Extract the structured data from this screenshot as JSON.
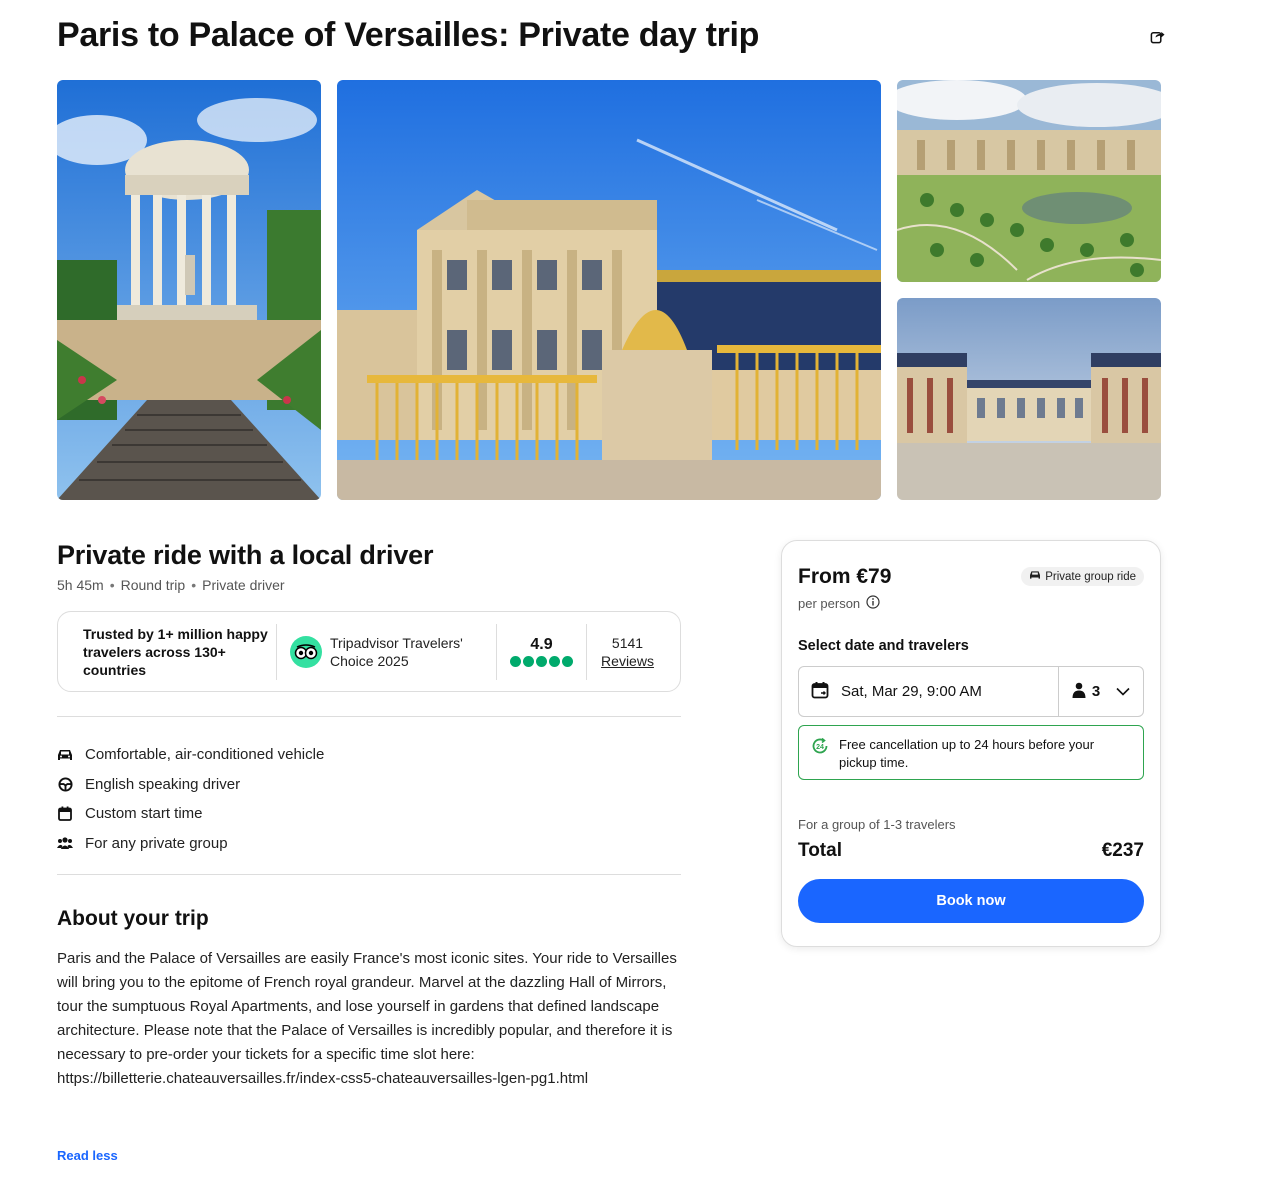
{
  "title": "Paris to Palace of Versailles: Private day trip",
  "gallery": {
    "photos": [
      "temple-of-love-photo",
      "palace-golden-gate-photo",
      "orangerie-gardens-photo",
      "marble-courtyard-photo"
    ]
  },
  "trip": {
    "heading": "Private ride with a local driver",
    "duration": "5h 45m",
    "trip_type": "Round trip",
    "driver": "Private driver",
    "separator": "•"
  },
  "trust": {
    "text": "Trusted by 1+ million happy travelers across 130+ countries",
    "award": "Tripadvisor Travelers' Choice 2025",
    "rating": "4.9",
    "stars": 5,
    "review_count": "5141",
    "reviews_label": "Reviews"
  },
  "features": [
    {
      "icon": "car-icon",
      "label": "Comfortable, air-conditioned vehicle"
    },
    {
      "icon": "steering-wheel-icon",
      "label": "English speaking driver"
    },
    {
      "icon": "calendar-icon",
      "label": "Custom start time"
    },
    {
      "icon": "group-icon",
      "label": "For any private group"
    }
  ],
  "about": {
    "heading": "About your trip",
    "text": "Paris and the Palace of Versailles are easily France's most iconic sites. Your ride to Versailles will bring you to the epitome of French royal grandeur. Marvel at the dazzling Hall of Mirrors, tour the sumptuous Royal Apartments, and lose yourself in gardens that defined landscape architecture. Please note that the Palace of Versailles is incredibly popular, and therefore it is necessary to pre-order your tickets for a specific time slot here: https://billetterie.chateauversailles.fr/index-css5-chateauversailles-lgen-pg1.html",
    "read_less": "Read less"
  },
  "booking": {
    "price": "From €79",
    "per_person": "per person",
    "badge": "Private group ride",
    "select_label": "Select date and travelers",
    "date": "Sat, Mar 29, 9:00 AM",
    "travelers": "3",
    "cancellation": "Free cancellation up to 24 hours before your pickup time.",
    "group_note": "For a group of 1-3 travelers",
    "total_label": "Total",
    "total_value": "€237",
    "book_button": "Book now"
  },
  "colors": {
    "accent": "#1a66ff",
    "rating_green": "#00aa6c",
    "cancel_green": "#2ea44f",
    "tripadvisor": "#34e0a1"
  }
}
